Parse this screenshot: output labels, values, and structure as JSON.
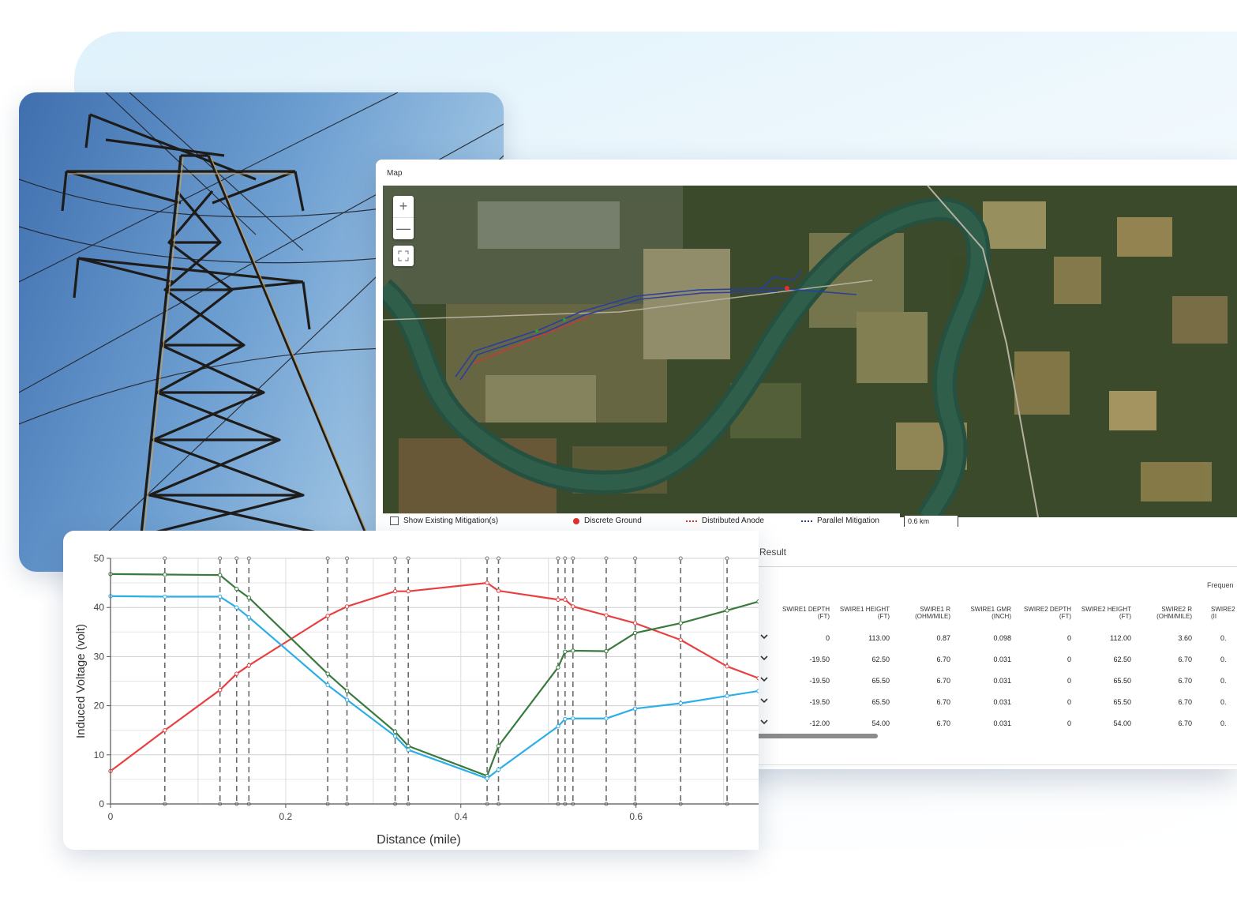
{
  "map_panel": {
    "title": "Map",
    "zoom_in_label": "+",
    "zoom_out_label": "—",
    "legend": {
      "show_existing": "Show Existing Mitigation(s)",
      "discrete_ground": "Discrete Ground",
      "distributed_anode": "Distributed Anode",
      "parallel_mitigation": "Parallel Mitigation"
    },
    "scale": "0.6 km",
    "colors": {
      "discrete_ground": "#e03030",
      "distributed_anode": "#e03030",
      "parallel_mitigation": "#2a3f9e"
    }
  },
  "result_panel": {
    "title": "Result",
    "frequency_label": "Frequen",
    "columns": [
      [
        "SWIRE1 DEPTH",
        "(FT)"
      ],
      [
        "SWIRE1 HEIGHT",
        "(FT)"
      ],
      [
        "SWIRE1 R",
        "(OHM/MILE)"
      ],
      [
        "SWIRE1 GMR",
        "(INCH)"
      ],
      [
        "SWIRE2 DEPTH",
        "(FT)"
      ],
      [
        "SWIRE2 HEIGHT",
        "(FT)"
      ],
      [
        "SWIRE2 R",
        "(OHM/MILE)"
      ],
      [
        "SWIRE2",
        "(II"
      ]
    ],
    "rows": [
      [
        "0",
        "113.00",
        "0.87",
        "0.098",
        "0",
        "112.00",
        "3.60",
        "0."
      ],
      [
        "-19.50",
        "62.50",
        "6.70",
        "0.031",
        "0",
        "62.50",
        "6.70",
        "0."
      ],
      [
        "-19.50",
        "65.50",
        "6.70",
        "0.031",
        "0",
        "65.50",
        "6.70",
        "0."
      ],
      [
        "-19.50",
        "65.50",
        "6.70",
        "0.031",
        "0",
        "65.50",
        "6.70",
        "0."
      ],
      [
        "-12.00",
        "54.00",
        "6.70",
        "0.031",
        "0",
        "54.00",
        "6.70",
        "0."
      ]
    ]
  },
  "chart_data": {
    "type": "line",
    "title": "",
    "xlabel": "Distance (mile)",
    "ylabel": "Induced Voltage (volt)",
    "xlim": [
      0,
      0.74
    ],
    "ylim": [
      0,
      50
    ],
    "x_ticks": [
      "0",
      "0.2",
      "0.4",
      "0.6"
    ],
    "y_ticks": [
      "0",
      "10",
      "20",
      "30",
      "40",
      "50"
    ],
    "grid": true,
    "markers_at": [
      0.062,
      0.125,
      0.144,
      0.158,
      0.248,
      0.27,
      0.325,
      0.34,
      0.43,
      0.443,
      0.511,
      0.519,
      0.528,
      0.566,
      0.599,
      0.651,
      0.704
    ],
    "series": [
      {
        "color": "#e84040",
        "x": [
          0,
          0.062,
          0.125,
          0.144,
          0.158,
          0.248,
          0.27,
          0.325,
          0.34,
          0.43,
          0.443,
          0.511,
          0.519,
          0.528,
          0.566,
          0.599,
          0.651,
          0.704,
          0.74
        ],
        "y": [
          6.7,
          15,
          23.2,
          26.5,
          28.2,
          38.3,
          40.2,
          43.3,
          43.3,
          45,
          43.4,
          41.6,
          41.6,
          40.2,
          38.4,
          36.8,
          33.4,
          28,
          25.6
        ]
      },
      {
        "color": "#3a7a3e",
        "x": [
          0,
          0.062,
          0.125,
          0.144,
          0.158,
          0.248,
          0.27,
          0.325,
          0.34,
          0.43,
          0.443,
          0.511,
          0.519,
          0.528,
          0.566,
          0.599,
          0.651,
          0.704,
          0.74
        ],
        "y": [
          46.8,
          46.7,
          46.6,
          43.8,
          42,
          26.5,
          23,
          14.7,
          11.8,
          5.7,
          11.8,
          27.8,
          31,
          31.2,
          31.1,
          34.8,
          36.8,
          39.4,
          41.2
        ]
      },
      {
        "color": "#2eaee8",
        "x": [
          0,
          0.062,
          0.125,
          0.144,
          0.158,
          0.248,
          0.27,
          0.325,
          0.34,
          0.43,
          0.443,
          0.511,
          0.519,
          0.528,
          0.566,
          0.599,
          0.651,
          0.704,
          0.74
        ],
        "y": [
          42.3,
          42.2,
          42.2,
          40,
          38,
          24.2,
          21.2,
          13.8,
          11,
          5.2,
          7,
          15.8,
          17.3,
          17.4,
          17.4,
          19.4,
          20.5,
          22,
          23
        ]
      }
    ]
  }
}
